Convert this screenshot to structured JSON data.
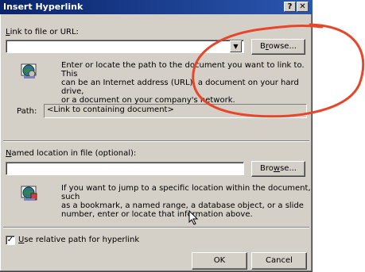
{
  "dialog": {
    "title": "Insert Hyperlink",
    "help_glyph": "?",
    "close_glyph": "✕",
    "link_label_mnemonic": "L",
    "link_label_rest": "ink to file or URL:",
    "link_value": "",
    "browse1_label_prefix": "B",
    "browse1_label_mnemonic": "r",
    "browse1_label_rest": "owse...",
    "help1_lines": [
      "Enter or locate the path to the document you want to link to.  This",
      "can be an Internet address (URL), a document on your hard drive,",
      "or a document on your company's network."
    ],
    "path_label": "Path:",
    "path_value": "<Link to containing document>",
    "named_label_mnemonic": "N",
    "named_label_rest": "amed location in file (optional):",
    "named_value": "",
    "browse2_label_prefix": "Bro",
    "browse2_label_mnemonic": "w",
    "browse2_label_rest": "se...",
    "help2_lines": [
      "If you want to jump to a specific location within the document, such",
      "as a bookmark, a named range, a database object, or a slide",
      "number, enter or locate that information above."
    ],
    "checkbox_checked": true,
    "checkbox_label_mnemonic": "U",
    "checkbox_label_rest": "se relative path for hyperlink",
    "ok_label": "OK",
    "cancel_label": "Cancel"
  },
  "icons": {
    "titlebar_help": "help-icon",
    "titlebar_close": "close-icon",
    "dropdown": "dropdown-arrow-icon",
    "info1": "hyperlink-globe-icon",
    "info2": "hyperlink-globe-icon",
    "cursor": "mouse-pointer-icon"
  },
  "colors": {
    "titlebar": "#0a246a",
    "dialog_face": "#d4d0c8",
    "annotation": "#e8462a"
  }
}
